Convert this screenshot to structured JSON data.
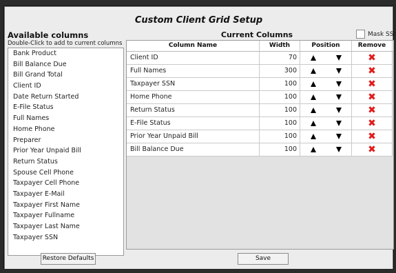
{
  "dialog": {
    "title": "Custom Client Grid Setup"
  },
  "available": {
    "title": "Available columns",
    "hint": "Double-Click to add to current columns",
    "items": [
      "Bank Product",
      "Bill Balance Due",
      "Bill Grand Total",
      "Client ID",
      "Date Return Started",
      "E-File Status",
      "Full Names",
      "Home Phone",
      "Preparer",
      "Prior Year Unpaid Bill",
      "Return Status",
      "Spouse Cell Phone",
      "Taxpayer Cell Phone",
      "Taxpayer E-Mail",
      "Taxpayer First Name",
      "Taxpayer Fullname",
      "Taxpayer Last Name",
      "Taxpayer SSN"
    ]
  },
  "current": {
    "title": "Current Columns",
    "mask_label": "Mask SSNs",
    "mask_checked": false,
    "headers": {
      "name": "Column Name",
      "width": "Width",
      "position": "Position",
      "remove": "Remove"
    },
    "rows": [
      {
        "name": "Client ID",
        "width": "70"
      },
      {
        "name": "Full Names",
        "width": "300"
      },
      {
        "name": "Taxpayer SSN",
        "width": "100"
      },
      {
        "name": "Home Phone",
        "width": "100"
      },
      {
        "name": "Return Status",
        "width": "100"
      },
      {
        "name": "E-File Status",
        "width": "100"
      },
      {
        "name": "Prior Year Unpaid Bill",
        "width": "100"
      },
      {
        "name": "Bill Balance Due",
        "width": "100"
      }
    ],
    "up_glyph": "▲",
    "down_glyph": "▼",
    "remove_glyph": "✖",
    "remove_color": "#e21b1b"
  },
  "buttons": {
    "restore": "Restore Defaults",
    "save": "Save"
  }
}
